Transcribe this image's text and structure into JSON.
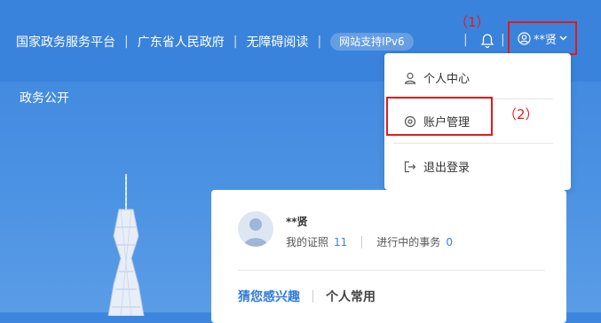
{
  "header": {
    "links": [
      "国家政务服务平台",
      "广东省人民政府",
      "无障碍阅读"
    ],
    "ipv6_badge": "网站支持IPv6",
    "user_name": "**贤"
  },
  "annotations": [
    "（1）",
    "（2）"
  ],
  "subnav": {
    "label": "政务公开"
  },
  "dropdown": {
    "items": [
      {
        "label": "个人中心",
        "icon": "user-icon"
      },
      {
        "label": "账户管理",
        "icon": "gear-icon"
      },
      {
        "label": "退出登录",
        "icon": "logout-icon"
      }
    ]
  },
  "card": {
    "user_name": "**贤",
    "certificates_label": "我的证照",
    "certificates_count": "11",
    "affairs_label": "进行中的事务",
    "affairs_count": "0",
    "tabs": [
      "猜您感兴趣",
      "个人常用"
    ]
  },
  "colors": {
    "accent": "#3a83dc",
    "annotation": "#e31b1b"
  }
}
